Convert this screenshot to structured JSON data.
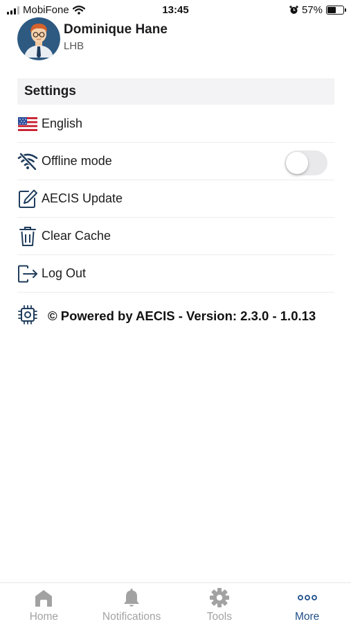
{
  "status_bar": {
    "carrier": "MobiFone",
    "time": "13:45",
    "battery": "57%",
    "battery_level": 0.57
  },
  "profile": {
    "name": "Dominique Hane",
    "organization": "LHB"
  },
  "settings": {
    "header": "Settings",
    "items": [
      {
        "label": "English",
        "icon": "us-flag-icon"
      },
      {
        "label": "Offline mode",
        "icon": "wifi-off-icon",
        "toggle_on": false
      },
      {
        "label": "AECIS Update",
        "icon": "edit-icon"
      },
      {
        "label": "Clear Cache",
        "icon": "trash-icon"
      },
      {
        "label": "Log Out",
        "icon": "logout-icon"
      }
    ]
  },
  "footer": {
    "text": "© Powered by AECIS - Version: 2.3.0 - 1.0.13",
    "icon": "chip-icon"
  },
  "tab_bar": {
    "tabs": [
      {
        "label": "Home",
        "icon": "home-icon",
        "active": false
      },
      {
        "label": "Notifications",
        "icon": "bell-icon",
        "active": false
      },
      {
        "label": "Tools",
        "icon": "gear-icon",
        "active": false
      },
      {
        "label": "More",
        "icon": "more-icon",
        "active": true
      }
    ]
  },
  "colors": {
    "accent": "#1f4e88",
    "inactive": "#a2a2a2",
    "header_bg": "#f3f3f5"
  }
}
